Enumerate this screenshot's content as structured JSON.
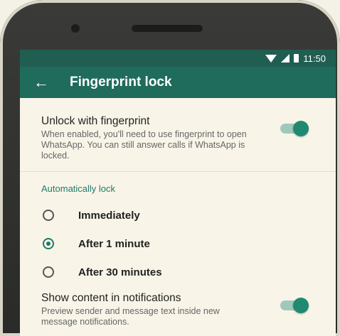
{
  "status_bar": {
    "time": "11:50"
  },
  "toolbar": {
    "back_icon": "arrow-left-icon",
    "title": "Fingerprint lock"
  },
  "unlock_setting": {
    "label": "Unlock with fingerprint",
    "description": "When enabled, you'll need to use fingerprint to open WhatsApp. You can still answer calls if WhatsApp is locked.",
    "enabled": true
  },
  "auto_lock": {
    "section_label": "Automatically lock",
    "options": [
      {
        "label": "Immediately",
        "selected": false
      },
      {
        "label": "After 1 minute",
        "selected": true
      },
      {
        "label": "After 30 minutes",
        "selected": false
      }
    ]
  },
  "notifications_setting": {
    "label": "Show content in notifications",
    "description": "Preview sender and message text inside new message notifications.",
    "enabled": true
  },
  "colors": {
    "toolbar": "#1f6b5c",
    "accent": "#1f7a66",
    "background": "#f8f5e8"
  }
}
